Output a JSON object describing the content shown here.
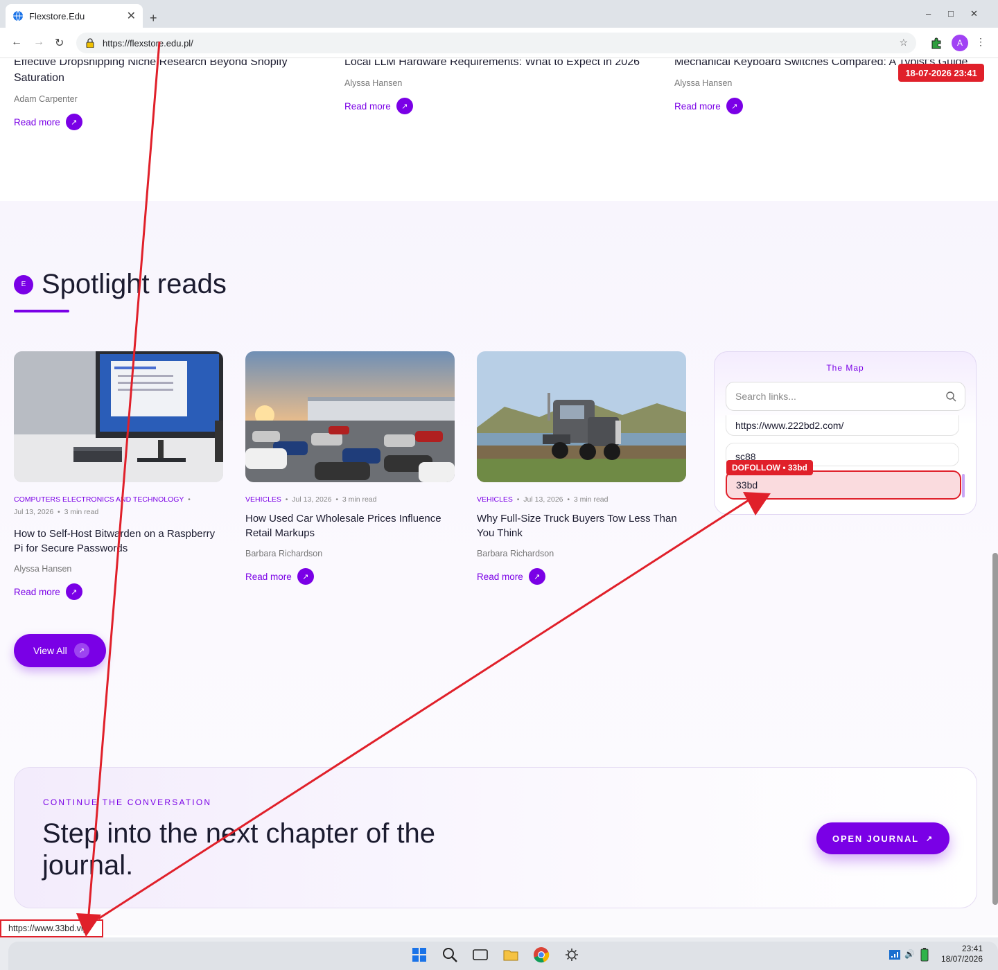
{
  "browser": {
    "tab_title": "Flexstore.Edu",
    "url": "https://flexstore.edu.pl/",
    "avatar_letter": "A"
  },
  "top_articles": [
    {
      "title": "Effective Dropshipping Niche Research Beyond Shopify Saturation",
      "author": "Adam Carpenter",
      "read_more": "Read more"
    },
    {
      "title": "Local LLM Hardware Requirements: What to Expect in 2026",
      "author": "Alyssa Hansen",
      "read_more": "Read more"
    },
    {
      "title": "Mechanical Keyboard Switches Compared: A Typist's Guide",
      "author": "Alyssa Hansen",
      "read_more": "Read more"
    }
  ],
  "date_badge": "18-07-2026 23:41",
  "spotlight": {
    "badge": "E",
    "title": "Spotlight reads",
    "view_all": "View All",
    "cards": [
      {
        "category": "COMPUTERS ELECTRONICS AND TECHNOLOGY",
        "date": "Jul 13, 2026",
        "read_time": "3 min read",
        "title": "How to Self-Host Bitwarden on a Raspberry Pi for Secure Passwords",
        "author": "Alyssa Hansen",
        "read_more": "Read more"
      },
      {
        "category": "VEHICLES",
        "date": "Jul 13, 2026",
        "read_time": "3 min read",
        "title": "How Used Car Wholesale Prices Influence Retail Markups",
        "author": "Barbara Richardson",
        "read_more": "Read more"
      },
      {
        "category": "VEHICLES",
        "date": "Jul 13, 2026",
        "read_time": "3 min read",
        "title": "Why Full-Size Truck Buyers Tow Less Than You Think",
        "author": "Barbara Richardson",
        "read_more": "Read more"
      }
    ]
  },
  "map": {
    "title": "The Map",
    "search_placeholder": "Search links...",
    "links": [
      "https://www.222bd2.com/",
      "sc88",
      "33bd"
    ],
    "dofollow_badge": "DOFOLLOW • 33bd"
  },
  "cta": {
    "kicker": "CONTINUE THE CONVERSATION",
    "title": "Step into the next chapter of the journal.",
    "button": "OPEN JOURNAL"
  },
  "status_url": "https://www.33bd.vip",
  "taskbar": {
    "time": "23:41",
    "date": "18/07/2026"
  },
  "colors": {
    "accent": "#7a00e6",
    "annotation": "#e0202a"
  }
}
